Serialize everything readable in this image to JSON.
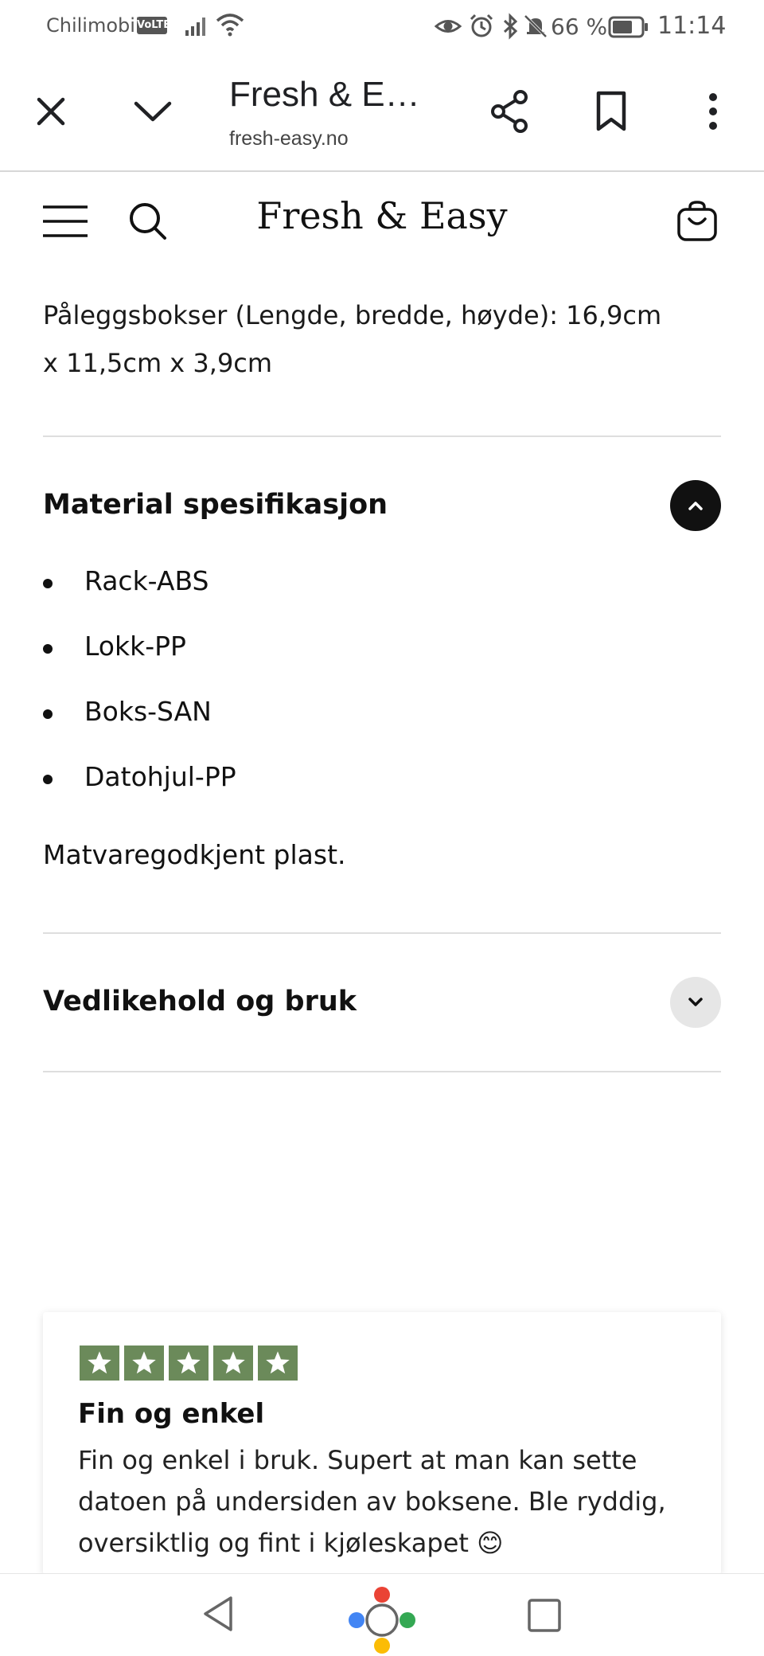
{
  "status_bar": {
    "carrier": "Chilimobil",
    "volte": "VoLTE",
    "battery_percent": "66 %",
    "time": "11:14",
    "icons": [
      "signal-icon",
      "wifi-icon",
      "eye-icon",
      "alarm-icon",
      "bluetooth-icon",
      "mute-icon",
      "battery-icon"
    ]
  },
  "browser": {
    "tab_title": "Fresh & Easy",
    "url": "fresh-easy.no",
    "icons": [
      "close-icon",
      "chevron-down-icon",
      "share-icon",
      "bookmark-icon",
      "more-vert-icon"
    ]
  },
  "site": {
    "title": "Fresh & Easy",
    "icons": [
      "menu-icon",
      "search-icon",
      "cart-icon"
    ]
  },
  "content": {
    "dimensions_line1": "Påleggsbokser (Lengde, bredde, høyde): 16,9cm",
    "dimensions_line2": "x 11,5cm x 3,9cm",
    "accordion_material": {
      "title": "Material spesifikasjon",
      "expanded": true,
      "items": [
        "Rack-ABS",
        "Lokk-PP",
        "Boks-SAN",
        "Datohjul-PP"
      ],
      "note": "Matvaregodkjent plast."
    },
    "accordion_care": {
      "title": "Vedlikehold og bruk",
      "expanded": false
    }
  },
  "review": {
    "rating": 5,
    "max_rating": 5,
    "star_color": "#6b8a5a",
    "title": "Fin og enkel",
    "body": "Fin og enkel i bruk. Supert at man kan sette datoen på undersiden av boksene. Ble ryddig, oversiktlig og fint i kjøleskapet 😊"
  },
  "nav": {
    "icons": [
      "back-icon",
      "home-assistant-icon",
      "recents-icon"
    ]
  }
}
